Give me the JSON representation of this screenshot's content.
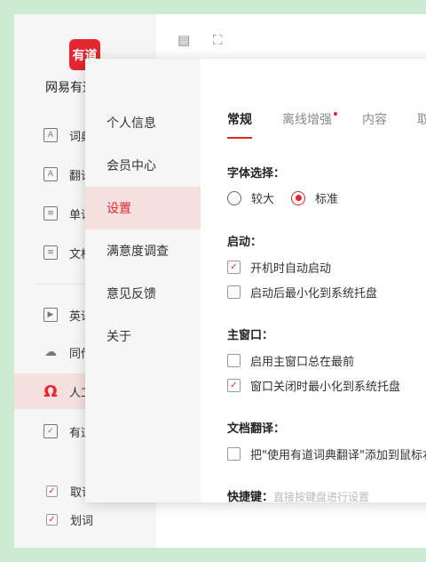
{
  "app": {
    "logo_text": "有道",
    "brand": "网易有道词典",
    "sidebar": [
      {
        "label": "词典",
        "icon": "dictionary-icon",
        "glyph": "A"
      },
      {
        "label": "翻译",
        "icon": "translate-icon",
        "glyph": "A"
      },
      {
        "label": "单词本",
        "icon": "wordbook-icon",
        "glyph": "≡"
      },
      {
        "label": "文档翻译",
        "icon": "document-icon",
        "glyph": "≡"
      },
      {
        "label": "英语课",
        "icon": "video-icon",
        "glyph": "▶"
      },
      {
        "label": "同传",
        "icon": "cloud-icon",
        "glyph": "☁"
      },
      {
        "label": "人工翻译",
        "icon": "human-translate-icon",
        "glyph": "Ω"
      },
      {
        "label": "有道云笔记",
        "icon": "note-check-icon",
        "glyph": "✓"
      }
    ],
    "bottom_checks": [
      {
        "label": "取词",
        "checked": true
      },
      {
        "label": "划词",
        "checked": true
      }
    ]
  },
  "dialog": {
    "nav": [
      "个人信息",
      "会员中心",
      "设置",
      "满意度调查",
      "意见反馈",
      "关于"
    ],
    "active_nav": 2,
    "tabs": [
      "常规",
      "离线增强",
      "内容",
      "取词"
    ],
    "sections": {
      "font": {
        "title": "字体选择：",
        "options": [
          {
            "label": "较大",
            "selected": false
          },
          {
            "label": "标准",
            "selected": true
          }
        ]
      },
      "startup": {
        "title": "启动：",
        "options": [
          {
            "label": "开机时自动启动",
            "checked": true
          },
          {
            "label": "启动后最小化到系统托盘",
            "checked": false
          }
        ]
      },
      "main_window": {
        "title": "主窗口：",
        "options": [
          {
            "label": "启用主窗口总在最前",
            "checked": false
          },
          {
            "label": "窗口关闭时最小化到系统托盘",
            "checked": true
          }
        ]
      },
      "doc_translate": {
        "title": "文档翻译：",
        "options": [
          {
            "label": "把\"使用有道词典翻译\"添加到鼠标右键菜单",
            "checked": false
          }
        ]
      },
      "shortcut": {
        "title": "快捷键：",
        "hint": "直接按键盘进行设置"
      }
    }
  },
  "colors": {
    "accent": "#e3262f",
    "background": "#cdebd2"
  }
}
